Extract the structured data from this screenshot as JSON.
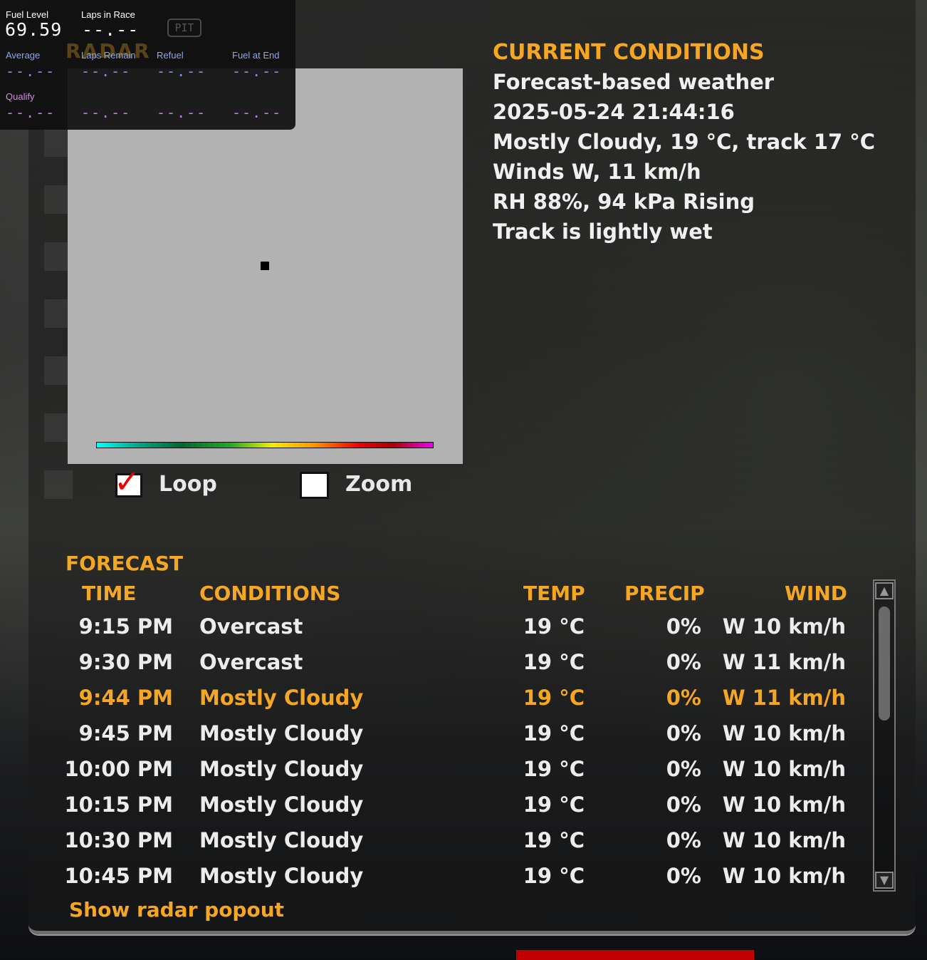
{
  "hud": {
    "fuel_level_label": "Fuel Level",
    "fuel_level_value": "69.59",
    "laps_in_race_label": "Laps in Race",
    "laps_in_race_value": "--.--",
    "pit_label": "PIT",
    "average_label": "Average",
    "laps_remain_label": "Laps Remain",
    "refuel_label": "Refuel",
    "fuel_at_end_label": "Fuel at End",
    "qualify_label": "Qualify",
    "average_row": [
      "--.--",
      "--.--",
      "--.--",
      "--.--"
    ],
    "qualify_row": [
      "--.--",
      "--.--",
      "--.--",
      "--.--"
    ]
  },
  "radar": {
    "ghost_title": "RADAR",
    "loop_label": "Loop",
    "loop_checked": true,
    "zoom_label": "Zoom",
    "zoom_checked": false
  },
  "current_conditions": {
    "title": "CURRENT CONDITIONS",
    "lines": [
      "Forecast-based weather",
      "2025-05-24 21:44:16",
      "Mostly Cloudy, 19 °C, track 17 °C",
      "Winds W, 11 km/h",
      "RH 88%, 94 kPa Rising",
      "Track is lightly wet"
    ]
  },
  "forecast": {
    "title": "FORECAST",
    "headers": {
      "time": "TIME",
      "conditions": "CONDITIONS",
      "temp": "TEMP",
      "precip": "PRECIP",
      "wind": "WIND"
    },
    "rows": [
      {
        "time": "9:15 PM",
        "conditions": "Overcast",
        "temp": "19 °C",
        "precip": "0%",
        "wind": "W 10 km/h"
      },
      {
        "time": "9:30 PM",
        "conditions": "Overcast",
        "temp": "19 °C",
        "precip": "0%",
        "wind": "W 11 km/h"
      },
      {
        "time": "9:44 PM",
        "conditions": "Mostly Cloudy",
        "temp": "19 °C",
        "precip": "0%",
        "wind": "W 11 km/h"
      },
      {
        "time": "9:45 PM",
        "conditions": "Mostly Cloudy",
        "temp": "19 °C",
        "precip": "0%",
        "wind": "W 10 km/h"
      },
      {
        "time": "10:00 PM",
        "conditions": "Mostly Cloudy",
        "temp": "19 °C",
        "precip": "0%",
        "wind": "W 10 km/h"
      },
      {
        "time": "10:15 PM",
        "conditions": "Mostly Cloudy",
        "temp": "19 °C",
        "precip": "0%",
        "wind": "W 10 km/h"
      },
      {
        "time": "10:30 PM",
        "conditions": "Mostly Cloudy",
        "temp": "19 °C",
        "precip": "0%",
        "wind": "W 10 km/h"
      },
      {
        "time": "10:45 PM",
        "conditions": "Mostly Cloudy",
        "temp": "19 °C",
        "precip": "0%",
        "wind": "W 10 km/h"
      }
    ],
    "current_row_index": 2,
    "popout_label": "Show radar popout"
  },
  "colors": {
    "accent": "#f5a623",
    "hud_blue": "#8ea6f0",
    "hud_violet": "#d58be6",
    "radar_bg": "#b2b2b2"
  }
}
